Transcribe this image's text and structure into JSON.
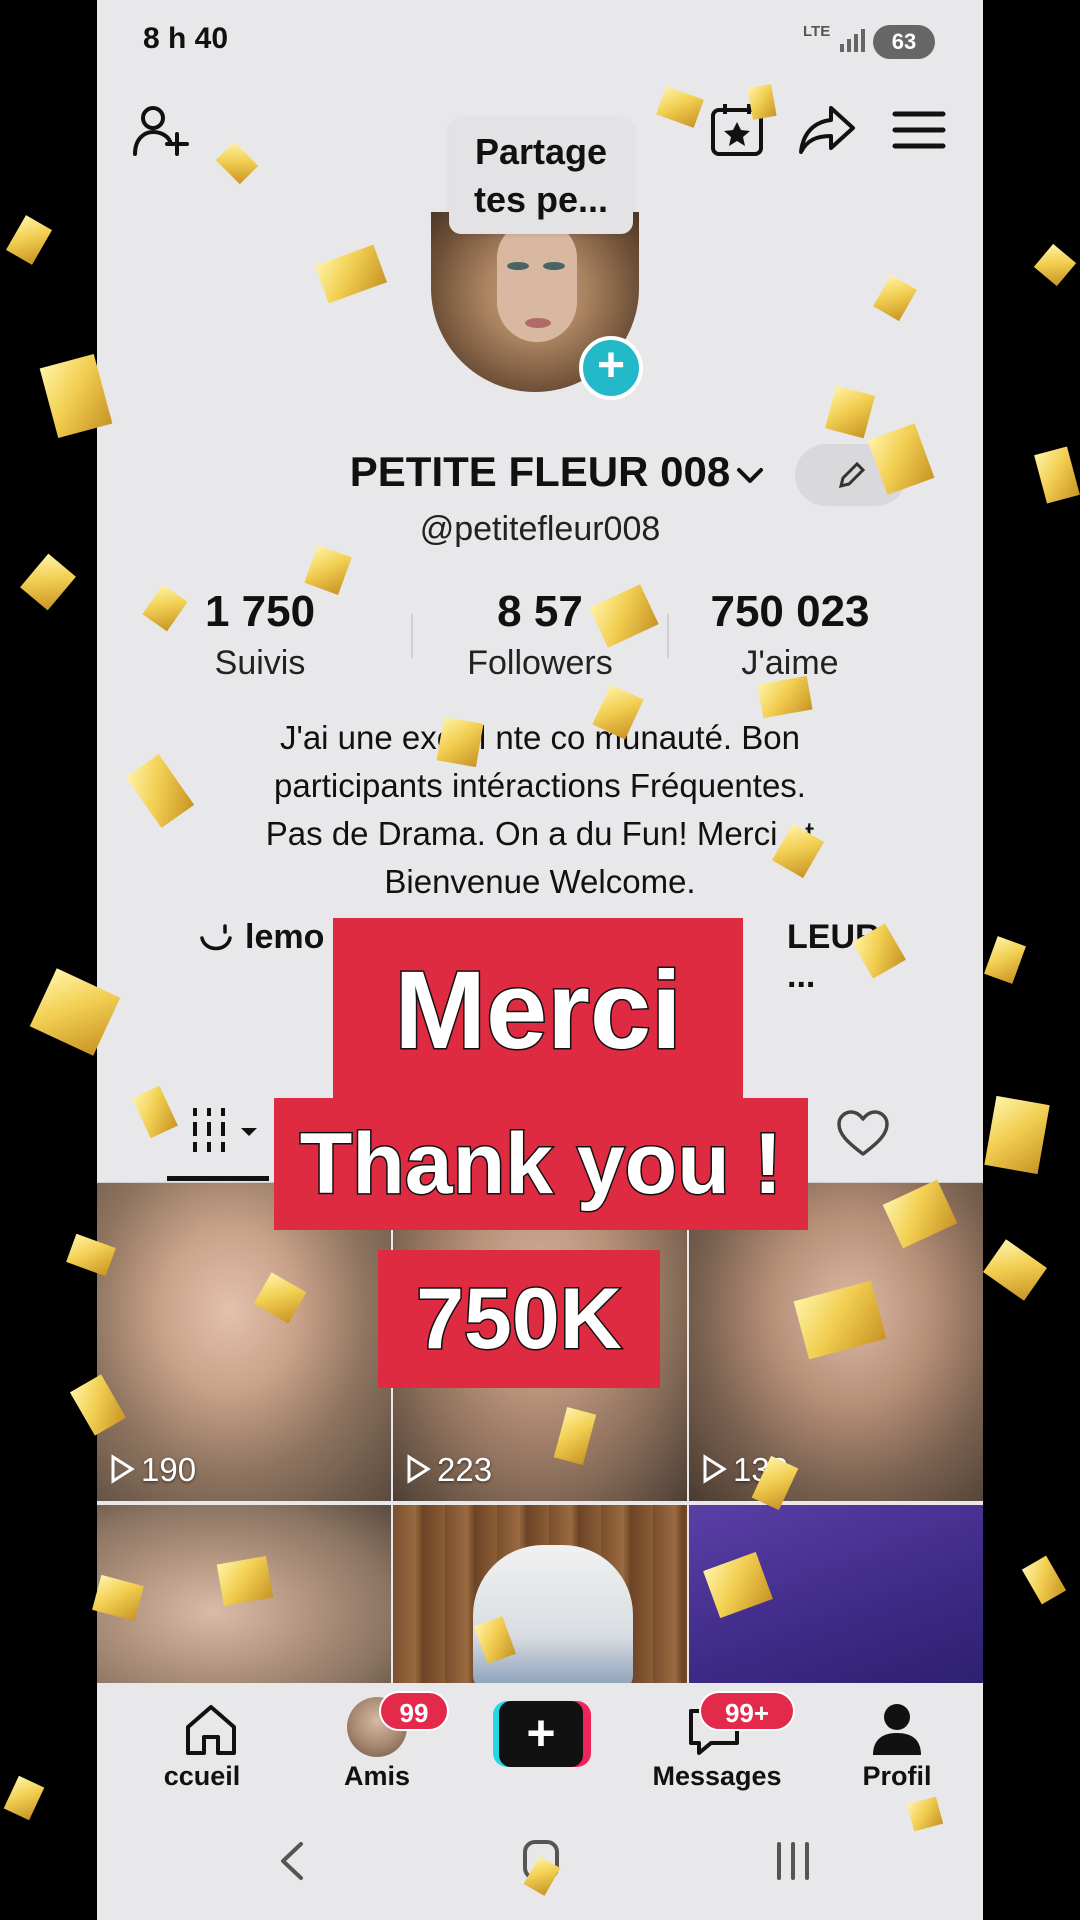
{
  "status_bar": {
    "time": "8 h 40",
    "network": "LTE",
    "battery": "63"
  },
  "tooltip": {
    "line1": "Partage",
    "line2": "tes pe..."
  },
  "profile": {
    "name": "PETITE FLEUR 008",
    "handle": "@petitefleur008",
    "stats": [
      {
        "value": "1 750",
        "label": "Suivis"
      },
      {
        "value": "8 57",
        "label": "Followers"
      },
      {
        "value": "750 023",
        "label": "J'aime"
      }
    ],
    "bio": [
      "J'ai une excell  nte co  munauté. Bon",
      "participants intéractions Fréquentes.",
      "Pas de Drama. On a du Fun! Merci et",
      "Bienvenue Welcome."
    ],
    "link_left": "lemo",
    "link_right": "LEUR ..."
  },
  "videos": [
    {
      "views": "190"
    },
    {
      "views": "223"
    },
    {
      "views": "132"
    },
    {
      "views": ""
    },
    {
      "views": ""
    },
    {
      "views": ""
    }
  ],
  "bottom_nav": {
    "home": "ccueil",
    "friends": "Amis",
    "friends_badge": "99",
    "messages": "Messages",
    "messages_badge": "99+",
    "profile": "Profil"
  },
  "captions": {
    "line1": "Merci",
    "line2": "Thank you !",
    "line3": "750K"
  },
  "colors": {
    "accent_red": "#de2b41",
    "badge_red": "#e42a4b",
    "teal": "#23b9c9",
    "confetti_gold": "#f2cf52"
  }
}
